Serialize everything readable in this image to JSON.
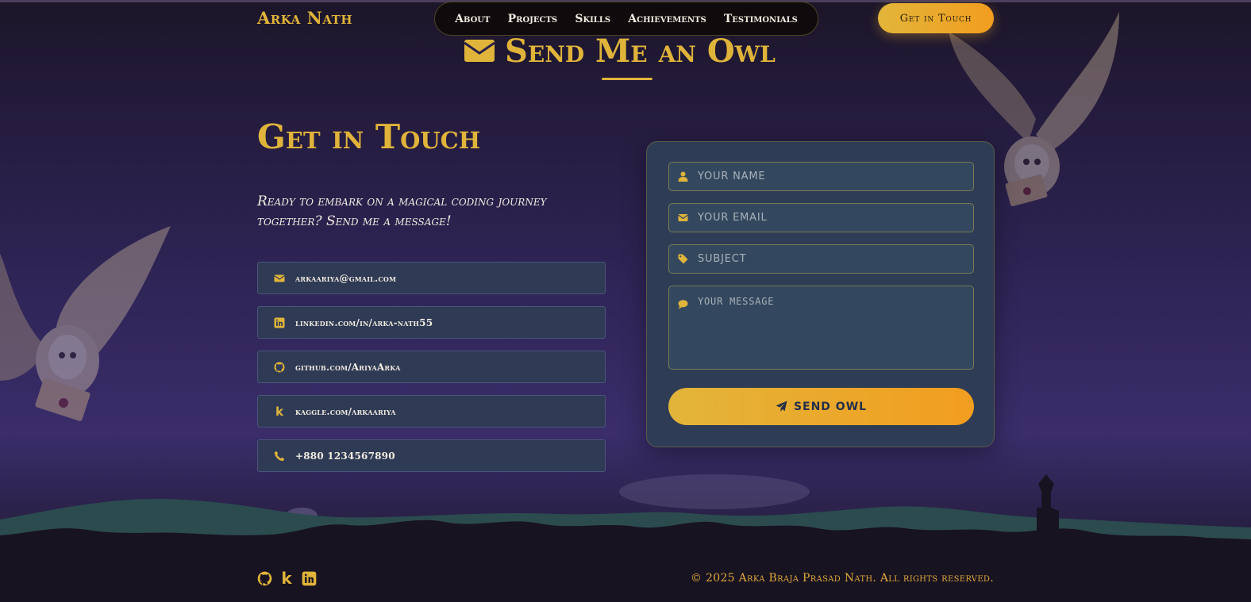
{
  "header": {
    "brand": "Arka Nath",
    "nav": [
      "About",
      "Projects",
      "Skills",
      "Achievements",
      "Testimonials"
    ],
    "cta": "Get in Touch"
  },
  "section": {
    "title": "Send Me an Owl",
    "icon": "envelope-icon"
  },
  "contact": {
    "heading": "Get in Touch",
    "intro": "Ready to embark on a magical coding journey together? Send me a message!",
    "items": [
      {
        "icon": "envelope-icon",
        "text": "arkaariya@gmail.com"
      },
      {
        "icon": "linkedin-icon",
        "text": "linkedin.com/in/arka-nath55"
      },
      {
        "icon": "github-icon",
        "text": "github.com/AriyaArka"
      },
      {
        "icon": "kaggle-icon",
        "text": "kaggle.com/arkaariya"
      },
      {
        "icon": "phone-icon",
        "text": "+880 1234567890"
      }
    ]
  },
  "form": {
    "name_placeholder": "YOUR NAME",
    "email_placeholder": "YOUR EMAIL",
    "subject_placeholder": "SUBJECT",
    "message_placeholder": "YOUR MESSAGE",
    "submit_label": "SEND OWL"
  },
  "footer": {
    "icons": [
      "github-icon",
      "kaggle-icon",
      "linkedin-icon"
    ],
    "copyright": "© 2025 Arka Braja Prasad Nath. All rights reserved."
  },
  "colors": {
    "gold": "#e0b43a",
    "orange": "#f29d1f",
    "card_bg": "#2e3d55",
    "night_sky": "#2e2455"
  }
}
